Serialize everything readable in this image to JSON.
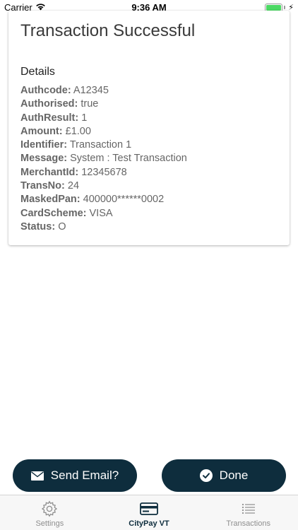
{
  "status_bar": {
    "carrier": "Carrier",
    "time": "9:36 AM",
    "battery_level": 1.0
  },
  "card": {
    "title": "Transaction Successful",
    "subtitle": "Details",
    "fields": [
      {
        "label": "Authcode:",
        "value": "A12345"
      },
      {
        "label": "Authorised:",
        "value": "true"
      },
      {
        "label": "AuthResult:",
        "value": "1"
      },
      {
        "label": "Amount:",
        "value": "£1.00"
      },
      {
        "label": "Identifier:",
        "value": "Transaction 1"
      },
      {
        "label": "Message:",
        "value": "System : Test Transaction"
      },
      {
        "label": "MerchantId:",
        "value": "12345678"
      },
      {
        "label": "TransNo:",
        "value": "24"
      },
      {
        "label": "MaskedPan:",
        "value": "400000******0002"
      },
      {
        "label": "CardScheme:",
        "value": "VISA"
      },
      {
        "label": "Status:",
        "value": "O"
      }
    ]
  },
  "actions": {
    "send_email_label": "Send Email?",
    "done_label": "Done"
  },
  "tabs": [
    {
      "label": "Settings",
      "icon": "gear-icon",
      "active": false
    },
    {
      "label": "CityPay VT",
      "icon": "credit-card-icon",
      "active": true
    },
    {
      "label": "Transactions",
      "icon": "list-icon",
      "active": false
    }
  ],
  "colors": {
    "primary": "#0e2d3d",
    "battery": "#4cd964",
    "tab_inactive": "#8e8e8e"
  }
}
